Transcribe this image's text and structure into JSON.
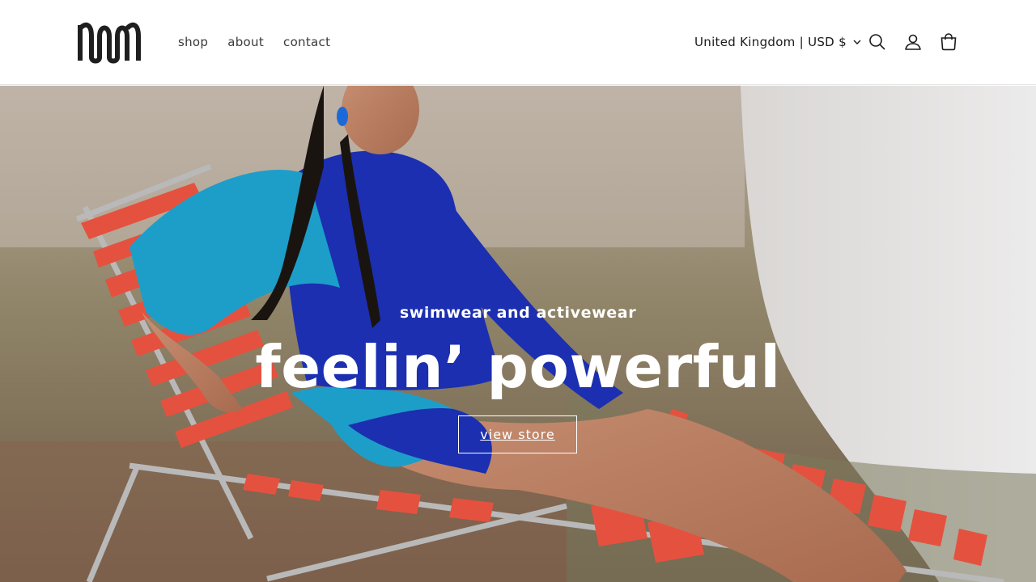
{
  "header": {
    "logo_alt": "MM logo",
    "nav": [
      "shop",
      "about",
      "contact"
    ],
    "locale": "United Kingdom | USD $",
    "icons": [
      "search-icon",
      "account-icon",
      "cart-icon"
    ]
  },
  "hero": {
    "subtitle": "swimwear and activewear",
    "title": "feelin’ powerful",
    "button": "view store"
  },
  "colors": {
    "header_bg": "#ffffff",
    "text": "#121212",
    "hero_text": "#ffffff",
    "chair_red": "#e8513f",
    "swim_blue": "#1b2fb0",
    "swim_cyan": "#1d9ec9"
  }
}
